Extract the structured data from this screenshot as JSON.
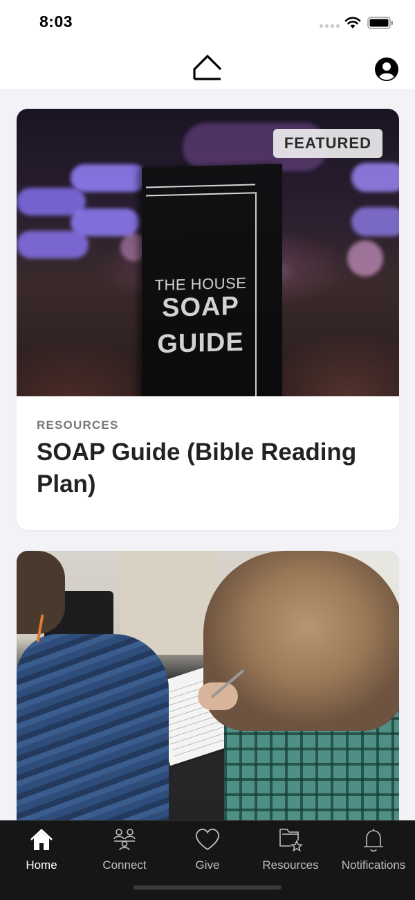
{
  "status_bar": {
    "time": "8:03"
  },
  "header": {
    "logo_icon": "house-roof-icon",
    "profile_icon": "person-circle-icon"
  },
  "feed": {
    "cards": [
      {
        "badge": "FEATURED",
        "cover_text": {
          "line1": "THE HOUSE",
          "line2": "SOAP",
          "line3": "GUIDE"
        },
        "category": "RESOURCES",
        "title": "SOAP Guide (Bible Reading Plan)"
      },
      {
        "image": "people-writing-photo"
      }
    ]
  },
  "tab_bar": {
    "active": "Home",
    "tabs": [
      {
        "label": "Home",
        "icon": "home-icon"
      },
      {
        "label": "Connect",
        "icon": "people-connect-icon"
      },
      {
        "label": "Give",
        "icon": "heart-icon"
      },
      {
        "label": "Resources",
        "icon": "folder-star-icon"
      },
      {
        "label": "Notifications",
        "icon": "bell-icon"
      }
    ]
  },
  "colors": {
    "tab_bar_bg": "#161616",
    "page_bg": "#f2f2f7",
    "card_bg": "#ffffff"
  }
}
